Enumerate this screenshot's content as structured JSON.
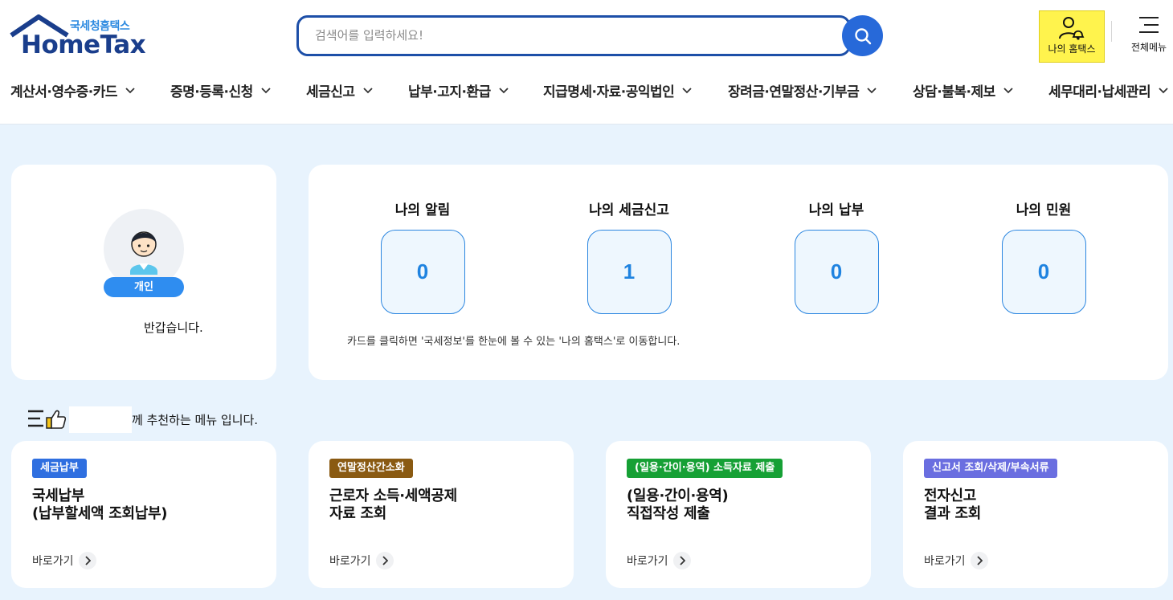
{
  "logo": {
    "sub": "국세청홈택스",
    "main": "HomeTax"
  },
  "search": {
    "placeholder": "검색어를 입력하세요!"
  },
  "header_right": {
    "my_hometax": "나의 홈택스",
    "all_menu": "전체메뉴"
  },
  "gnb": [
    {
      "label": "계산서·영수증·카드"
    },
    {
      "label": "증명·등록·신청"
    },
    {
      "label": "세금신고"
    },
    {
      "label": "납부·고지·환급"
    },
    {
      "label": "지급명세·자료·공익법인"
    },
    {
      "label": "장려금·연말정산·기부금"
    },
    {
      "label": "상담·불복·제보"
    },
    {
      "label": "세무대리·납세관리"
    }
  ],
  "profile": {
    "badge": "개인",
    "welcome": "반갑습니다."
  },
  "status": {
    "items": [
      {
        "title": "나의 알림",
        "count": "0"
      },
      {
        "title": "나의 세금신고",
        "count": "1"
      },
      {
        "title": "나의 납부",
        "count": "0"
      },
      {
        "title": "나의 민원",
        "count": "0"
      }
    ],
    "note": "카드를 클릭하면 '국세정보'를 한눈에 볼 수 있는 '나의 홈택스'로 이동합니다."
  },
  "recommend": {
    "text": "께 추천하는 메뉴 입니다."
  },
  "menus": [
    {
      "tag": "세금납부",
      "tag_color": "#2f6fe0",
      "title_line1": "국세납부",
      "title_line2": "(납부할세액 조회납부)",
      "goto": "바로가기"
    },
    {
      "tag": "연말정산간소화",
      "tag_color": "#8a5a12",
      "title_line1": "근로자 소득·세액공제",
      "title_line2": "자료 조회",
      "goto": "바로가기"
    },
    {
      "tag": "(일용·간이·용역) 소득자료 제출",
      "tag_color": "#16a035",
      "title_line1": "(일용·간이·용역)",
      "title_line2": "직접작성 제출",
      "goto": "바로가기"
    },
    {
      "tag": "신고서 조회/삭제/부속서류",
      "tag_color": "#6a6ee0",
      "title_line1": "전자신고",
      "title_line2": "결과 조회",
      "goto": "바로가기"
    }
  ]
}
